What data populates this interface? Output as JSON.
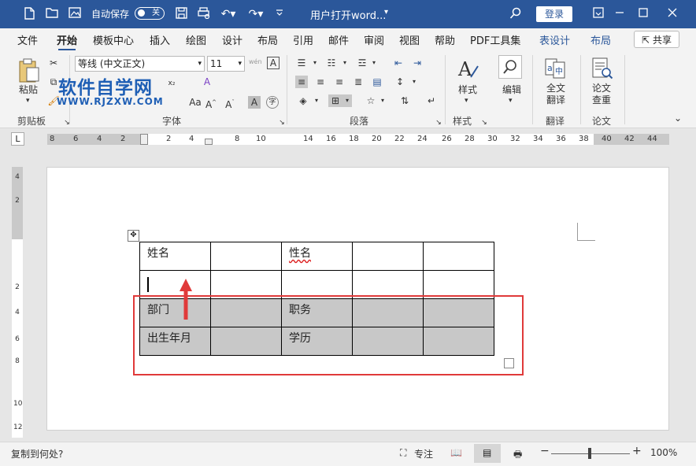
{
  "titlebar": {
    "autosave_label": "自动保存",
    "autosave_state": "关",
    "doc_title": "用户打开word...",
    "login_label": "登录"
  },
  "tabs": [
    "文件",
    "开始",
    "模板中心",
    "插入",
    "绘图",
    "设计",
    "布局",
    "引用",
    "邮件",
    "审阅",
    "视图",
    "帮助",
    "PDF工具集",
    "表设计",
    "布局"
  ],
  "share_label": "共享",
  "ribbon": {
    "paste_label": "粘贴",
    "font_name": "等线 (中文正文)",
    "font_size": "11",
    "styles_label": "样式",
    "edit_label": "编辑",
    "translate_label1": "全文",
    "translate_label2": "翻译",
    "paper_label1": "论文",
    "paper_label2": "查重",
    "groups": {
      "clipboard": "剪贴板",
      "font": "字体",
      "paragraph": "段落",
      "styles": "样式",
      "translate": "翻译",
      "paper": "论文"
    }
  },
  "watermark": {
    "title": "软件自学网",
    "url": "WWW.RJZXW.COM"
  },
  "ruler": {
    "h_numbers": [
      "8",
      "6",
      "4",
      "2",
      "2",
      "4",
      "8",
      "10",
      "14",
      "16",
      "18",
      "20",
      "22",
      "24",
      "26",
      "28",
      "30",
      "32",
      "34",
      "36",
      "38",
      "40",
      "42",
      "44"
    ],
    "v_numbers": [
      "4",
      "2",
      "2",
      "4",
      "6",
      "8",
      "10",
      "12"
    ]
  },
  "table": {
    "rows": [
      [
        "姓名",
        "",
        "性名",
        "",
        ""
      ],
      [
        "",
        "",
        "",
        "",
        ""
      ],
      [
        "部门",
        "",
        "职务",
        "",
        ""
      ],
      [
        "出生年月",
        "",
        "学历",
        "",
        ""
      ]
    ]
  },
  "statusbar": {
    "left_text": "复制到何处?",
    "focus_label": "专注",
    "zoom": "100%"
  },
  "colors": {
    "title_bg": "#2b579a",
    "selection": "#c8c8c8",
    "highlight_box": "#e03a3a",
    "arrow": "#e03a3a"
  }
}
